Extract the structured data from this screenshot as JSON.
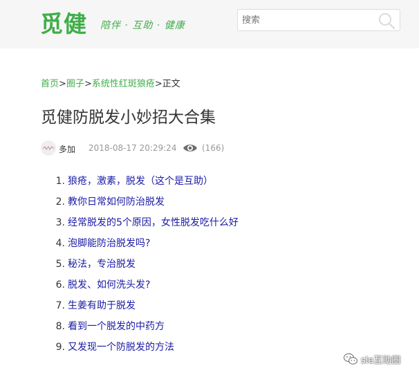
{
  "header": {
    "logo": "觅健",
    "slogan": "陪伴 · 互助 · 健康",
    "search_placeholder": "搜索"
  },
  "breadcrumb": {
    "items": [
      "首页",
      "圈子",
      "系统性红斑狼疮"
    ],
    "separator": ">",
    "current": "正文"
  },
  "article": {
    "title": "觅健防脱发小妙招大合集",
    "author": "多加",
    "date": "2018-08-17 20:29:24",
    "views": "(166)",
    "items": [
      {
        "num": "1.",
        "text": "狼疮，激素，脱发（这个是互助）"
      },
      {
        "num": "2.",
        "text": "教你日常如何防治脱发"
      },
      {
        "num": "3.",
        "text": "经常脱发的5个原因，女性脱发吃什么好"
      },
      {
        "num": "4.",
        "text": "泡脚能防治脱发吗?"
      },
      {
        "num": "5.",
        "text": "秘法，专治脱发"
      },
      {
        "num": "6.",
        "text": "脱发、如何洗头发?"
      },
      {
        "num": "7.",
        "text": "生姜有助于脱发"
      },
      {
        "num": "8.",
        "text": "看到一个脱发的中药方"
      },
      {
        "num": "9.",
        "text": "又发现一个防脱发的方法"
      }
    ]
  },
  "watermark": "sle互助圈",
  "colors": {
    "brand": "#3fae49",
    "link": "#1a1aa6",
    "header_bg": "#f6f6f6"
  }
}
